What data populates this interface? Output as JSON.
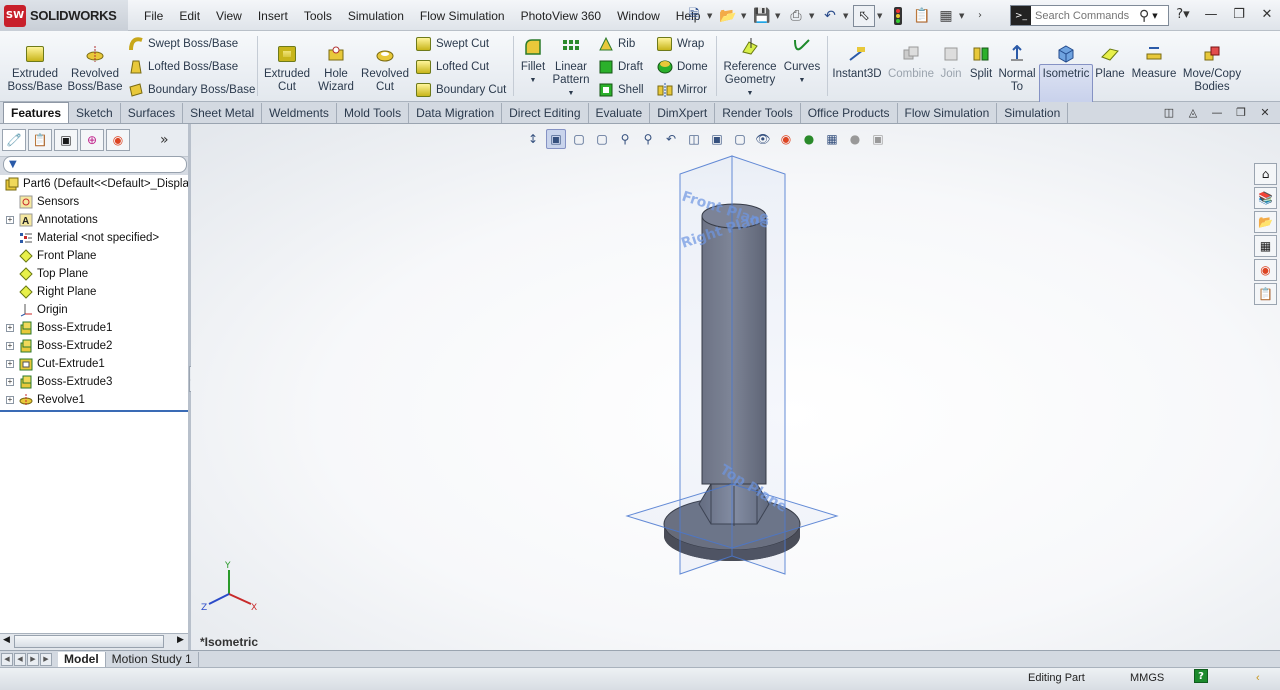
{
  "app": {
    "brand": "SOLIDWORKS",
    "logo_text": "SW"
  },
  "menu": [
    "File",
    "Edit",
    "View",
    "Insert",
    "Tools",
    "Simulation",
    "Flow Simulation",
    "PhotoView 360",
    "Window",
    "Help"
  ],
  "search": {
    "placeholder": "Search Commands"
  },
  "ribbon": {
    "extruded_boss": "Extruded Boss/Base",
    "revolved_boss": "Revolved Boss/Base",
    "swept_boss": "Swept Boss/Base",
    "lofted_boss": "Lofted Boss/Base",
    "boundary_boss": "Boundary Boss/Base",
    "extruded_cut": "Extruded Cut",
    "hole_wizard": "Hole Wizard",
    "revolved_cut": "Revolved Cut",
    "swept_cut": "Swept Cut",
    "lofted_cut": "Lofted Cut",
    "boundary_cut": "Boundary Cut",
    "fillet": "Fillet",
    "linear_pattern": "Linear Pattern",
    "rib": "Rib",
    "draft": "Draft",
    "shell": "Shell",
    "wrap": "Wrap",
    "dome": "Dome",
    "mirror": "Mirror",
    "reference_geometry": "Reference Geometry",
    "curves": "Curves",
    "instant3d": "Instant3D",
    "combine": "Combine",
    "join": "Join",
    "split": "Split",
    "normal_to": "Normal To",
    "isometric": "Isometric",
    "plane": "Plane",
    "measure": "Measure",
    "move_copy": "Move/Copy Bodies"
  },
  "command_tabs": [
    "Features",
    "Sketch",
    "Surfaces",
    "Sheet Metal",
    "Weldments",
    "Mold Tools",
    "Data Migration",
    "Direct Editing",
    "Evaluate",
    "DimXpert",
    "Render Tools",
    "Office Products",
    "Flow Simulation",
    "Simulation"
  ],
  "active_tab": "Features",
  "tree": [
    {
      "label": "Part6  (Default<<Default>_Displa",
      "icon": "part-icon",
      "expandable": false,
      "indent": 0
    },
    {
      "label": "Sensors",
      "icon": "sensor-icon",
      "expandable": false,
      "indent": 1
    },
    {
      "label": "Annotations",
      "icon": "annotation-icon",
      "expandable": true,
      "indent": 1
    },
    {
      "label": "Material <not specified>",
      "icon": "material-icon",
      "expandable": false,
      "indent": 1
    },
    {
      "label": "Front Plane",
      "icon": "plane-icon",
      "expandable": false,
      "indent": 1
    },
    {
      "label": "Top Plane",
      "icon": "plane-icon",
      "expandable": false,
      "indent": 1
    },
    {
      "label": "Right Plane",
      "icon": "plane-icon",
      "expandable": false,
      "indent": 1
    },
    {
      "label": "Origin",
      "icon": "origin-icon",
      "expandable": false,
      "indent": 1
    },
    {
      "label": "Boss-Extrude1",
      "icon": "extrude-icon",
      "expandable": true,
      "indent": 1
    },
    {
      "label": "Boss-Extrude2",
      "icon": "extrude-icon",
      "expandable": true,
      "indent": 1
    },
    {
      "label": "Cut-Extrude1",
      "icon": "cut-icon",
      "expandable": true,
      "indent": 1
    },
    {
      "label": "Boss-Extrude3",
      "icon": "extrude-icon",
      "expandable": true,
      "indent": 1
    },
    {
      "label": "Revolve1",
      "icon": "revolve-icon",
      "expandable": true,
      "indent": 1
    }
  ],
  "viewport": {
    "view_name": "*Isometric",
    "plane_labels": {
      "front": "Front Plane",
      "right": "Right Plane",
      "top": "Top Plane"
    },
    "triad": {
      "x": "X",
      "y": "Y",
      "z": "Z"
    }
  },
  "bottom_tabs": [
    "Model",
    "Motion Study 1"
  ],
  "status": {
    "mode": "Editing Part",
    "units": "MMGS",
    "help": "?"
  }
}
